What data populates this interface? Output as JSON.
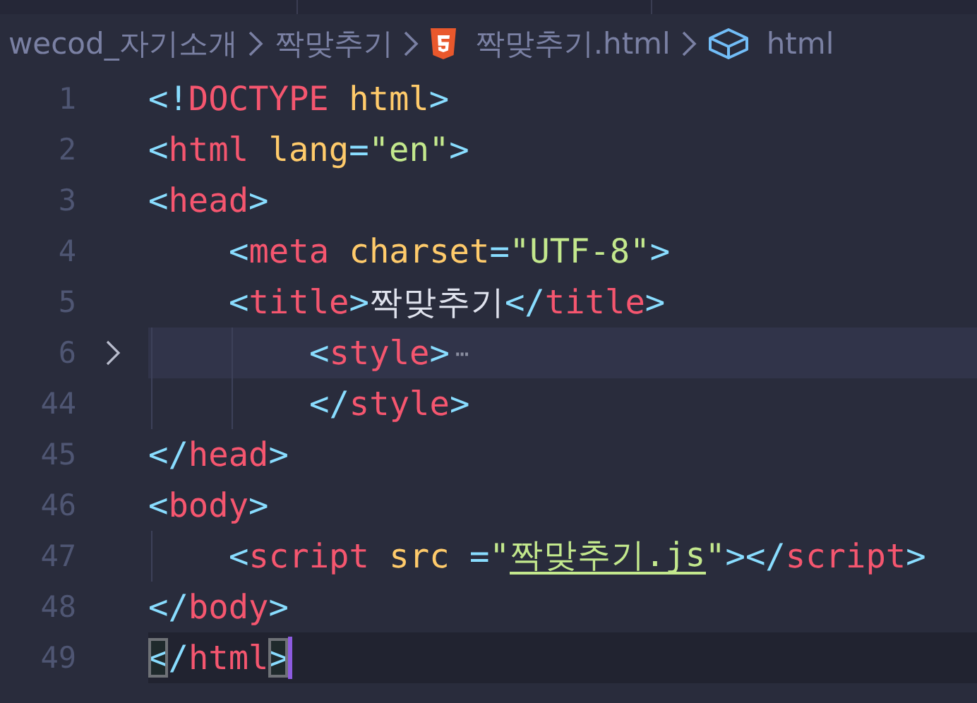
{
  "breadcrumb": [
    {
      "kind": "folder",
      "label": "wecod_자기소개"
    },
    {
      "kind": "folder",
      "label": "짝맞추기"
    },
    {
      "kind": "html-file",
      "label": "짝맞추기.html"
    },
    {
      "kind": "element",
      "label": "html"
    }
  ],
  "lines": [
    {
      "number": "1",
      "guides": false,
      "folded": false,
      "current": false,
      "tokens": [
        {
          "kind": "punct",
          "text": "<!"
        },
        {
          "kind": "tag",
          "text": "DOCTYPE"
        },
        {
          "kind": "attr",
          "text": " html"
        },
        {
          "kind": "punct",
          "text": ">"
        }
      ]
    },
    {
      "number": "2",
      "guides": false,
      "folded": false,
      "current": false,
      "tokens": [
        {
          "kind": "punct",
          "text": "<"
        },
        {
          "kind": "tag",
          "text": "html"
        },
        {
          "kind": "attr",
          "text": " lang"
        },
        {
          "kind": "punct",
          "text": "="
        },
        {
          "kind": "string",
          "text": "\"en\""
        },
        {
          "kind": "punct",
          "text": ">"
        }
      ]
    },
    {
      "number": "3",
      "guides": false,
      "folded": false,
      "current": false,
      "tokens": [
        {
          "kind": "punct",
          "text": "<"
        },
        {
          "kind": "tag",
          "text": "head"
        },
        {
          "kind": "punct",
          "text": ">"
        }
      ],
      "children": [
        {
          "number": "4",
          "guides": false,
          "folded": false,
          "current": false,
          "tokens": [
            {
              "kind": "punct",
              "text": "<"
            },
            {
              "kind": "tag",
              "text": "meta"
            },
            {
              "kind": "attr",
              "text": " charset"
            },
            {
              "kind": "punct",
              "text": "="
            },
            {
              "kind": "string",
              "text": "\"UTF-8\""
            },
            {
              "kind": "punct",
              "text": ">"
            }
          ]
        },
        {
          "number": "5",
          "guides": false,
          "folded": false,
          "current": false,
          "tokens": [
            {
              "kind": "punct",
              "text": "<"
            },
            {
              "kind": "tag",
              "text": "title"
            },
            {
              "kind": "punct",
              "text": ">"
            },
            {
              "kind": "text",
              "text": "짝맞추기"
            },
            {
              "kind": "punct",
              "text": "</"
            },
            {
              "kind": "tag",
              "text": "title"
            },
            {
              "kind": "punct",
              "text": ">"
            }
          ],
          "children": [
            {
              "number": "6",
              "guides": true,
              "folded": true,
              "current": false,
              "fold_marker": "⋯",
              "tokens": [
                {
                  "kind": "punct",
                  "text": "<"
                },
                {
                  "kind": "tag",
                  "text": "style"
                },
                {
                  "kind": "punct",
                  "text": ">"
                }
              ]
            },
            {
              "number": "44",
              "guides": true,
              "folded": false,
              "current": false,
              "tokens": [
                {
                  "kind": "punct",
                  "text": "</"
                },
                {
                  "kind": "tag",
                  "text": "style"
                },
                {
                  "kind": "punct",
                  "text": ">"
                }
              ]
            }
          ]
        }
      ]
    },
    {
      "number": "45",
      "guides": false,
      "folded": false,
      "current": false,
      "tokens": [
        {
          "kind": "punct",
          "text": "</"
        },
        {
          "kind": "tag",
          "text": "head"
        },
        {
          "kind": "punct",
          "text": ">"
        }
      ]
    },
    {
      "number": "46",
      "guides": false,
      "folded": false,
      "current": false,
      "tokens": [
        {
          "kind": "punct",
          "text": "<"
        },
        {
          "kind": "tag",
          "text": "body"
        },
        {
          "kind": "punct",
          "text": ">"
        }
      ],
      "children": [
        {
          "number": "47",
          "guides": true,
          "folded": false,
          "current": false,
          "tokens": [
            {
              "kind": "punct",
              "text": "<"
            },
            {
              "kind": "tag",
              "text": "script"
            },
            {
              "kind": "attr",
              "text": " src"
            },
            {
              "kind": "punct",
              "text": " ="
            },
            {
              "kind": "string",
              "text": "\""
            },
            {
              "kind": "link",
              "text": "짝맞추기.js"
            },
            {
              "kind": "string",
              "text": "\""
            },
            {
              "kind": "punct",
              "text": "></"
            },
            {
              "kind": "tag",
              "text": "script"
            },
            {
              "kind": "punct",
              "text": ">"
            }
          ]
        }
      ]
    },
    {
      "number": "48",
      "guides": false,
      "folded": false,
      "current": false,
      "tokens": [
        {
          "kind": "punct",
          "text": "</"
        },
        {
          "kind": "tag",
          "text": "body"
        },
        {
          "kind": "punct",
          "text": ">"
        }
      ]
    },
    {
      "number": "49",
      "guides": false,
      "folded": false,
      "current": true,
      "tokens": [
        {
          "kind": "match",
          "text": "<"
        },
        {
          "kind": "punct",
          "text": "/"
        },
        {
          "kind": "tag",
          "text": "html"
        },
        {
          "kind": "match",
          "text": ">"
        }
      ]
    }
  ]
}
